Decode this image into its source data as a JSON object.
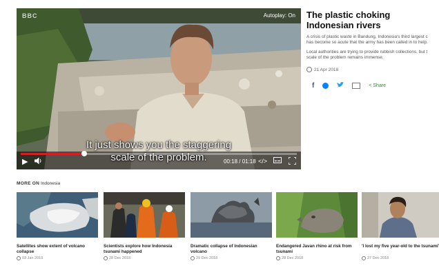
{
  "player": {
    "watermark": "BBC",
    "autoplay_label": "Autoplay: On",
    "subtitle_line1": "It just shows you the staggering",
    "subtitle_line2": "scale of the problem.",
    "progress": 0.23,
    "time": "00:18 / 01:18",
    "icons": [
      "play-icon",
      "volume-icon",
      "embed-icon",
      "captions-icon",
      "fullscreen-icon"
    ]
  },
  "article": {
    "title": "The plastic choking Indonesian rivers",
    "para1_line1": "A crisis of plastic waste in Bandung, Indonesia's third largest c",
    "para1_line2": "has become so acute that the army has been called in to help.",
    "para2_line1": "Local authorities are trying to provide rubbish collections, but t",
    "para2_line2": "scale of the problem remains immense.",
    "date": "21 Apr 2018",
    "share_label": "Share",
    "share_icons": [
      "facebook-icon",
      "messenger-icon",
      "twitter-icon",
      "email-icon",
      "share-icon"
    ]
  },
  "more_on": {
    "label": "MORE ON",
    "topic": "Indonesia"
  },
  "cards": [
    {
      "title": "Satellites show extent of volcano collapse",
      "date": "03 Jan 2019"
    },
    {
      "title": "Scientists explore how Indonesia tsunami happened",
      "date": "28 Dec 2018"
    },
    {
      "title": "Dramatic collapse of Indonesian volcano",
      "date": "29 Dec 2018"
    },
    {
      "title": "Endangered Javan rhino at risk from tsunami",
      "date": "28 Dec 2018"
    },
    {
      "title": "'I lost my five year-old to the tsunami'",
      "date": "27 Dec 2018"
    }
  ],
  "colors": {
    "progress_accent": "#d21f26",
    "share_green": "#2a8a2a",
    "facebook": "#3b5998",
    "twitter": "#1da1f2",
    "messenger": "#0084ff"
  }
}
